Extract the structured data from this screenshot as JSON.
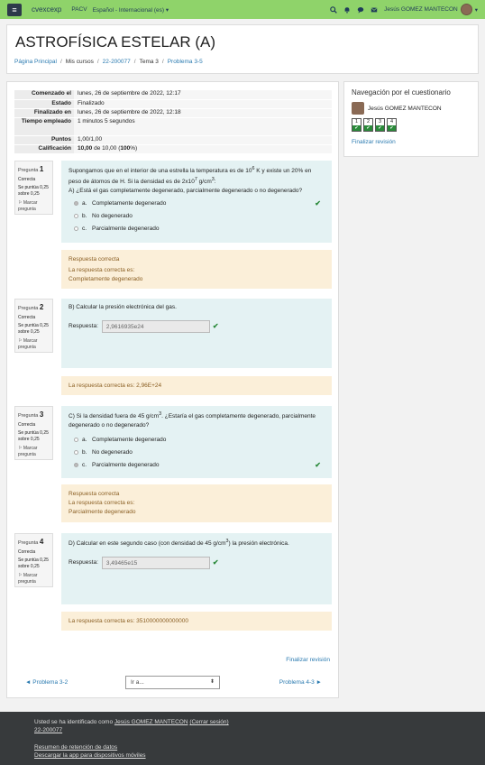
{
  "nav": {
    "brand": "cvexcexp",
    "link": "PACV",
    "lang": "Español - Internacional (es)",
    "user": "Jesús GOMEZ MANTECON"
  },
  "header": {
    "title": "ASTROFÍSICA ESTELAR (A)",
    "crumbs": [
      "Página Principal",
      "Mis cursos",
      "22-200077",
      "Tema 3",
      "Problema 3-5"
    ]
  },
  "summary": [
    {
      "k": "Comenzado el",
      "v": "lunes, 26 de septiembre de 2022, 12:17"
    },
    {
      "k": "Estado",
      "v": "Finalizado"
    },
    {
      "k": "Finalizado en",
      "v": "lunes, 26 de septiembre de 2022, 12:18"
    },
    {
      "k": "Tiempo empleado",
      "v": "1 minutos 5 segundos"
    },
    {
      "k": "Puntos",
      "v": "1,00/1,00"
    }
  ],
  "grade": {
    "k": "Calificación",
    "v1": "10,00",
    "v2": " de 10,00 (",
    "v3": "100",
    "v4": "%)"
  },
  "qinfo": {
    "pregunta": "Pregunta",
    "correcta": "Correcta",
    "score": "Se puntúa 0,25 sobre 0,25",
    "mark": "Marcar pregunta"
  },
  "q1": {
    "num": "1",
    "text_a": "Supongamos que en el interior de una estrella la temperatura es de 10",
    "sup1": "6",
    "text_b": " K y existe un 20% en peso de átomos de H. Si la densidad es de 2x10",
    "sup2": "7",
    "text_c": " g/cm",
    "sup3": "3",
    "text_d": ":",
    "sub": "A) ¿Está el gas completamente degenerado, parcialmente degenerado o no degenerado?",
    "options": [
      {
        "l": "a.",
        "t": "Completamente degenerado"
      },
      {
        "l": "b.",
        "t": "No degenerado"
      },
      {
        "l": "c.",
        "t": "Parcialmente degenerado"
      }
    ],
    "fb1": "Respuesta correcta",
    "fb2": "La respuesta correcta es:",
    "fb3": "Completamente degenerado"
  },
  "q2": {
    "num": "2",
    "text": "B) Calcular la presión electrónica del gas.",
    "label": "Respuesta:",
    "value": "2,9616935e24",
    "fb": "La respuesta correcta es: 2,96E+24"
  },
  "q3": {
    "num": "3",
    "text_a": "C) Si la densidad fuera de 45 g/cm",
    "sup": "3",
    "text_b": ". ¿Estaría el gas completamente degenerado, parcialmente degenerado o no degenerado?",
    "options": [
      {
        "l": "a.",
        "t": "Completamente degenerado"
      },
      {
        "l": "b.",
        "t": "No degenerado"
      },
      {
        "l": "c.",
        "t": "Parcialmente degenerado"
      }
    ],
    "fb1": "Respuesta correcta",
    "fb2": "La respuesta correcta es:",
    "fb3": "Parcialmente degenerado"
  },
  "q4": {
    "num": "4",
    "text_a": "D) Calcular en este segundo caso (con densidad de 45 g/cm",
    "sup": "3",
    "text_b": ") la presión electrónica.",
    "label": "Respuesta:",
    "value": "3,49465e15",
    "fb": "La respuesta correcta es: 3510000000000000"
  },
  "qnav": {
    "title": "Navegación por el cuestionario",
    "user": "Jesús GOMEZ MANTECON",
    "buttons": [
      "1",
      "2",
      "3",
      "4"
    ],
    "finish": "Finalizar revisión"
  },
  "bottom": {
    "finish": "Finalizar revisión",
    "prev": "◄ Problema 3-2",
    "jump": "Ir a...",
    "next": "Problema 4-3 ►"
  },
  "footer": {
    "logged": "Usted se ha identificado como",
    "user": "Jesús GOMEZ MANTECON",
    "logout": "(Cerrar sesión)",
    "course": "22-200077",
    "retention": "Resumen de retención de datos",
    "app": "Descargar la app para dispositivos móviles"
  }
}
